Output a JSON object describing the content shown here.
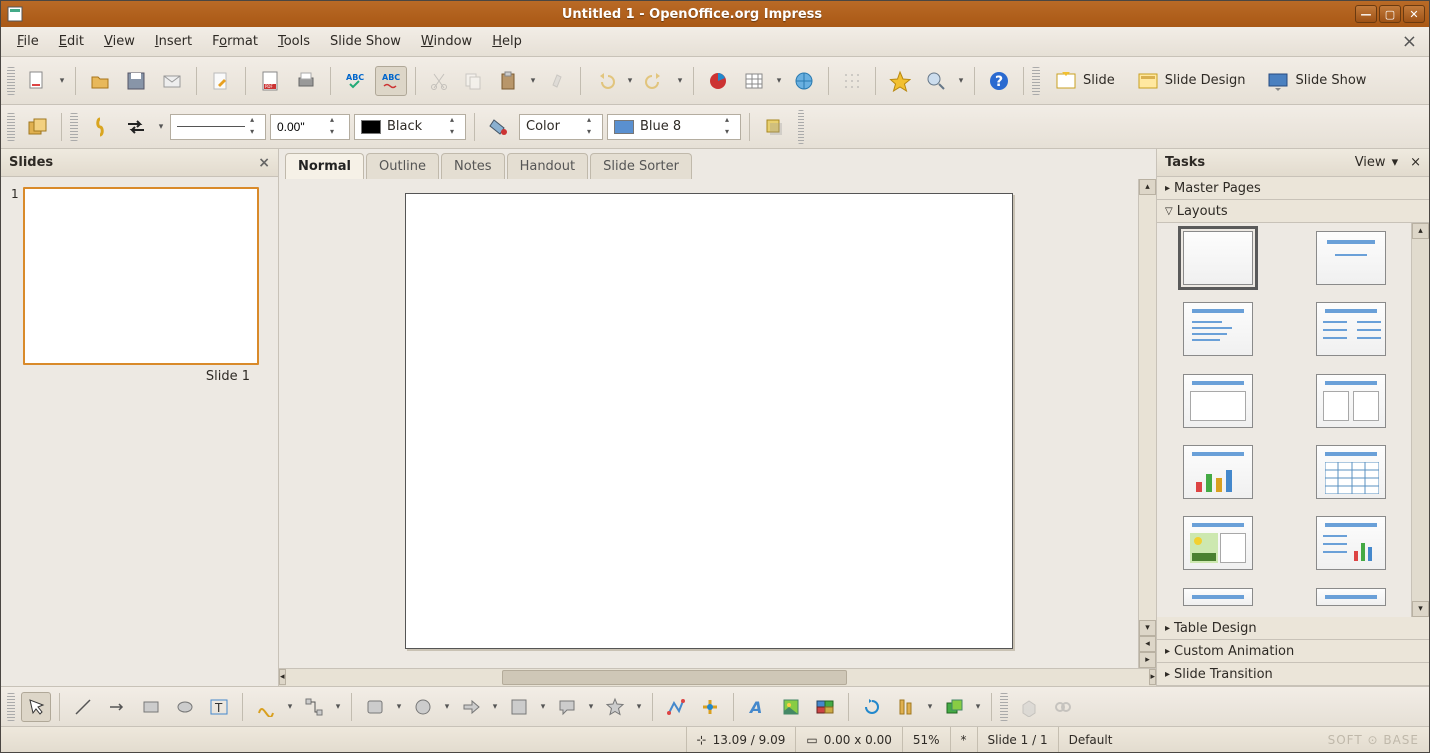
{
  "title": "Untitled 1 - OpenOffice.org Impress",
  "menu": {
    "file": "File",
    "edit": "Edit",
    "view": "View",
    "insert": "Insert",
    "format": "Format",
    "tools": "Tools",
    "slideshow": "Slide Show",
    "window": "Window",
    "help": "Help"
  },
  "toolbar1_right": {
    "slide": "Slide",
    "slide_design": "Slide Design",
    "slide_show": "Slide Show"
  },
  "toolbar2": {
    "line_width": "0.00\"",
    "line_color_label": "Black",
    "fill_type": "Color",
    "fill_color_label": "Blue 8"
  },
  "slides_panel": {
    "title": "Slides",
    "thumb_num": "1",
    "thumb_caption": "Slide 1"
  },
  "view_tabs": {
    "normal": "Normal",
    "outline": "Outline",
    "notes": "Notes",
    "handout": "Handout",
    "sorter": "Slide Sorter"
  },
  "tasks_panel": {
    "title": "Tasks",
    "view_label": "View",
    "sections": {
      "master_pages": "Master Pages",
      "layouts": "Layouts",
      "table_design": "Table Design",
      "custom_animation": "Custom Animation",
      "slide_transition": "Slide Transition"
    }
  },
  "statusbar": {
    "coords": "13.09 / 9.09",
    "size": "0.00 x 0.00",
    "zoom": "51%",
    "modified": "*",
    "slide_counter": "Slide 1 / 1",
    "template": "Default"
  },
  "watermark": "SOFT ⊙ BASE"
}
